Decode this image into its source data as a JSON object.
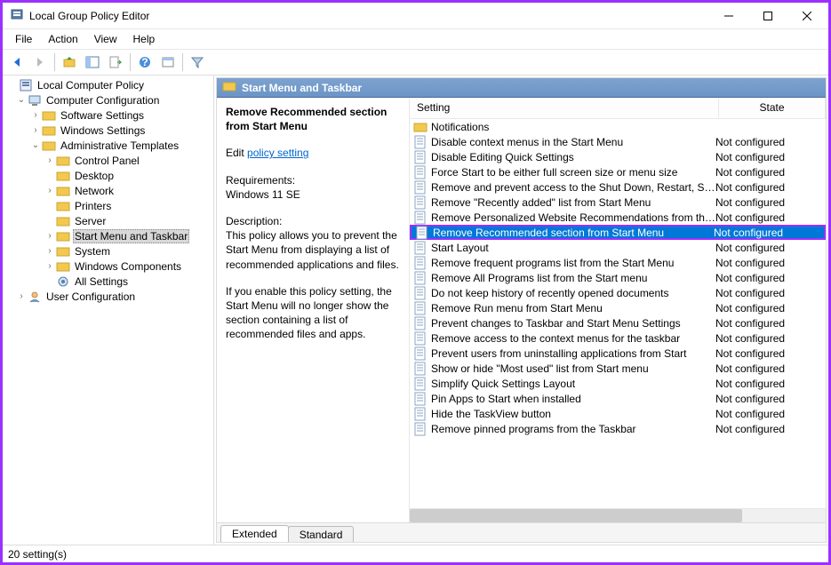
{
  "window": {
    "title": "Local Group Policy Editor"
  },
  "menus": [
    "File",
    "Action",
    "View",
    "Help"
  ],
  "tree": {
    "root": "Local Computer Policy",
    "cc": "Computer Configuration",
    "sw": "Software Settings",
    "ws": "Windows Settings",
    "at": "Administrative Templates",
    "cp": "Control Panel",
    "dk": "Desktop",
    "nw": "Network",
    "pr": "Printers",
    "sv": "Server",
    "st": "Start Menu and Taskbar",
    "sy": "System",
    "wc": "Windows Components",
    "as": "All Settings",
    "uc": "User Configuration"
  },
  "breadcrumb": "Start Menu and Taskbar",
  "info": {
    "title": "Remove Recommended section from Start Menu",
    "edit_prefix": "Edit",
    "edit_link": "policy setting",
    "req_label": "Requirements:",
    "req_value": "Windows 11 SE",
    "desc_label": "Description:",
    "desc_value": "This policy allows you to prevent the Start Menu from displaying a list of recommended applications and files.",
    "desc_more": "If you enable this policy setting, the Start Menu will no longer show the section containing a list of recommended files and apps."
  },
  "columns": {
    "setting": "Setting",
    "state": "State"
  },
  "rows": [
    {
      "type": "folder",
      "name": "Notifications",
      "state": ""
    },
    {
      "type": "policy",
      "name": "Disable context menus in the Start Menu",
      "state": "Not configured"
    },
    {
      "type": "policy",
      "name": "Disable Editing Quick Settings",
      "state": "Not configured"
    },
    {
      "type": "policy",
      "name": "Force Start to be either full screen size or menu size",
      "state": "Not configured"
    },
    {
      "type": "policy",
      "name": "Remove and prevent access to the Shut Down, Restart, Sleep...",
      "state": "Not configured"
    },
    {
      "type": "policy",
      "name": "Remove \"Recently added\" list from Start Menu",
      "state": "Not configured"
    },
    {
      "type": "policy",
      "name": "Remove Personalized Website Recommendations from the ...",
      "state": "Not configured"
    },
    {
      "type": "policy",
      "name": "Remove Recommended section from Start Menu",
      "state": "Not configured",
      "selected": true,
      "highlighted": true
    },
    {
      "type": "policy",
      "name": "Start Layout",
      "state": "Not configured"
    },
    {
      "type": "policy",
      "name": "Remove frequent programs list from the Start Menu",
      "state": "Not configured"
    },
    {
      "type": "policy",
      "name": "Remove All Programs list from the Start menu",
      "state": "Not configured"
    },
    {
      "type": "policy",
      "name": "Do not keep history of recently opened documents",
      "state": "Not configured"
    },
    {
      "type": "policy",
      "name": "Remove Run menu from Start Menu",
      "state": "Not configured"
    },
    {
      "type": "policy",
      "name": "Prevent changes to Taskbar and Start Menu Settings",
      "state": "Not configured"
    },
    {
      "type": "policy",
      "name": "Remove access to the context menus for the taskbar",
      "state": "Not configured"
    },
    {
      "type": "policy",
      "name": "Prevent users from uninstalling applications from Start",
      "state": "Not configured"
    },
    {
      "type": "policy",
      "name": "Show or hide \"Most used\" list from Start menu",
      "state": "Not configured"
    },
    {
      "type": "policy",
      "name": "Simplify Quick Settings Layout",
      "state": "Not configured"
    },
    {
      "type": "policy",
      "name": "Pin Apps to Start when installed",
      "state": "Not configured"
    },
    {
      "type": "policy",
      "name": "Hide the TaskView button",
      "state": "Not configured"
    },
    {
      "type": "policy",
      "name": "Remove pinned programs from the Taskbar",
      "state": "Not configured"
    }
  ],
  "tabs": {
    "extended": "Extended",
    "standard": "Standard"
  },
  "status": "20 setting(s)"
}
